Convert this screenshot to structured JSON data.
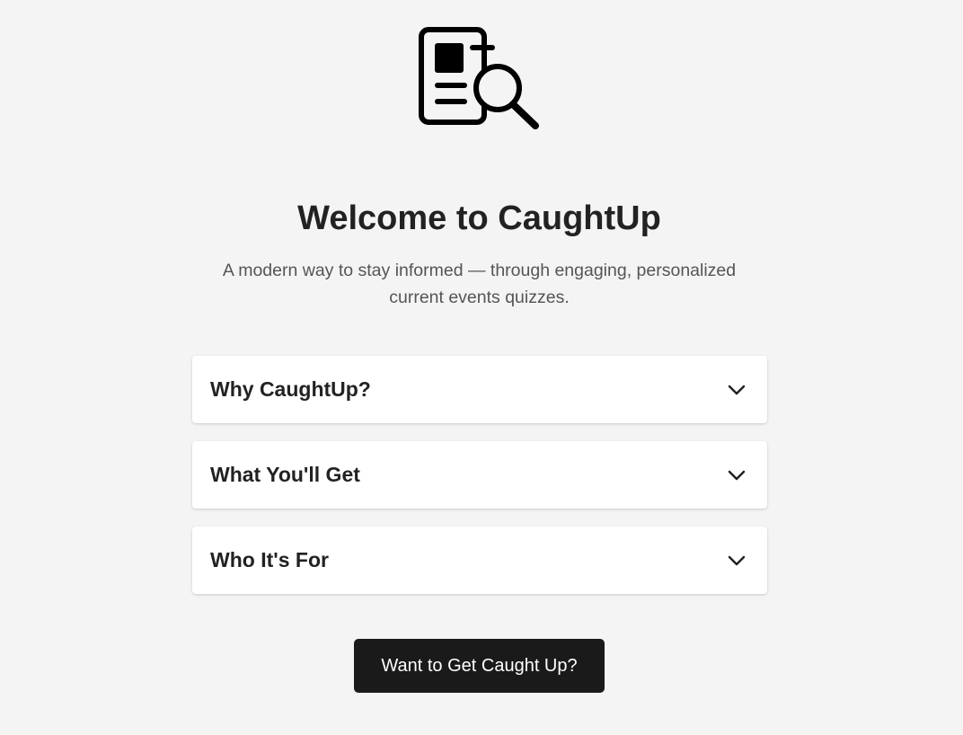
{
  "logo": {
    "icon": "news-search-icon"
  },
  "hero": {
    "title": "Welcome to CaughtUp",
    "subtitle": "A modern way to stay informed — through engaging, personalized current events quizzes."
  },
  "accordions": [
    {
      "label": "Why CaughtUp?",
      "icon": "chevron-down-icon",
      "expanded": false
    },
    {
      "label": "What You'll Get",
      "icon": "chevron-down-icon",
      "expanded": false
    },
    {
      "label": "Who It's For",
      "icon": "chevron-down-icon",
      "expanded": false
    }
  ],
  "cta": {
    "label": "Want to Get Caught Up?"
  },
  "colors": {
    "background": "#f4f4f4",
    "card": "#ffffff",
    "text": "#222222",
    "muted": "#555555",
    "button": "#1a1a1a"
  }
}
